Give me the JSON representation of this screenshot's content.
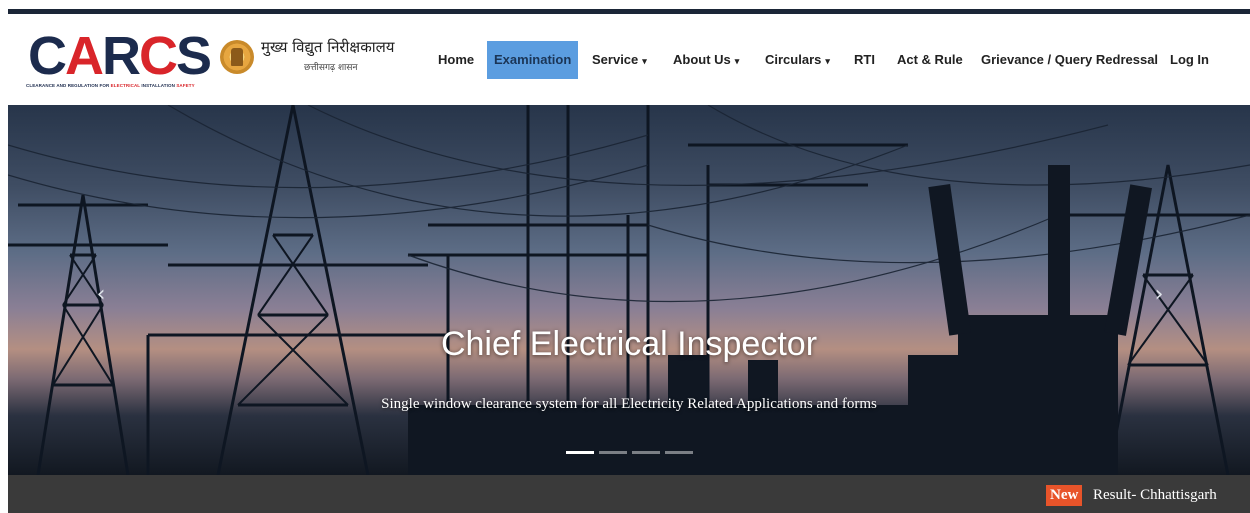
{
  "brand": {
    "logo_text_1": "C",
    "logo_text_2": "A",
    "logo_text_3": "R",
    "logo_text_4": "C",
    "logo_text_5": "S",
    "tagline_1": "CLEARANCE AND REGULATION FOR ",
    "tagline_2": "ELECTRICAL",
    "tagline_3": " INSTALLATION ",
    "tagline_4": "SAFETY",
    "hindi_title": "मुख्य विद्युत निरीक्षकालय",
    "hindi_sub": "छत्तीसगढ़ शासन",
    "accent_color": "#d9252a",
    "navy_color": "#1c2b4d"
  },
  "nav": {
    "home": "Home",
    "examination": "Examination",
    "service": "Service",
    "about": "About Us",
    "circulars": "Circulars",
    "rti": "RTI",
    "act_rule": "Act & Rule",
    "grievance": "Grievance / Query Redressal",
    "login": "Log In",
    "caret": "▾",
    "active_color": "#5b9de0"
  },
  "carousel": {
    "title": "Chief Electrical Inspector",
    "subtitle": "Single window clearance system for all Electricity Related Applications and forms",
    "prev_icon": "chevron-left-icon",
    "next_icon": "chevron-right-icon",
    "prev_glyph": "‹",
    "next_glyph": "›",
    "slide_count": 4,
    "active_index": 0
  },
  "ticker": {
    "badge": "New",
    "text": "Result- Chhattisgarh",
    "badge_color": "#e8542a",
    "background": "#3a3a3a"
  }
}
